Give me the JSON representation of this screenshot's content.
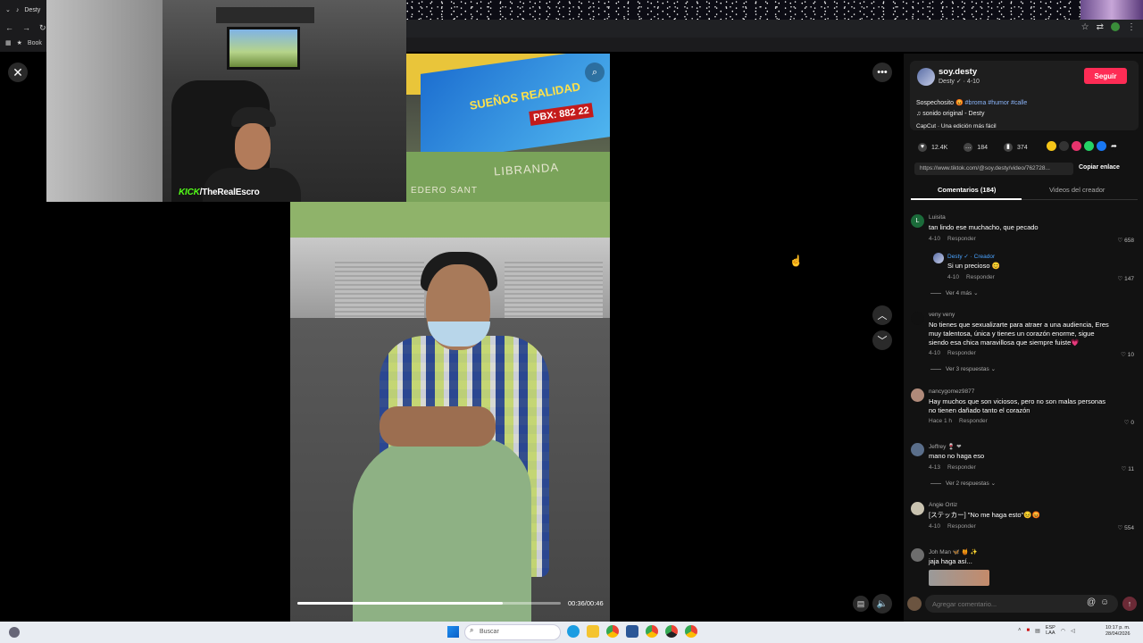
{
  "browser": {
    "tab_title": "Desty",
    "bookmarks_label": "Book"
  },
  "stream_overlay": {
    "kick_brand": "KICK",
    "channel": "/TheRealEscro"
  },
  "video": {
    "sign_text": "SUEÑOS REALIDAD",
    "pbx_text": "PBX: 882 22",
    "wall_text_left": "EDERO SANT",
    "wall_text_right": "LIBRANDA",
    "time": "00:36/00:46",
    "progress": 0.78
  },
  "creator": {
    "handle": "soy.desty",
    "name_line": "Desty ✓ · 4-10",
    "follow_label": "Seguir",
    "desc_text": "Sospechosito 😡",
    "desc_tags": "#broma #humor #calle",
    "music": "♫ sonido original - Desty",
    "capcut": "CapCut · Una edición más fácil"
  },
  "stats": {
    "likes": "12.4K",
    "comments": "184",
    "saves": "374"
  },
  "link": {
    "url": "https://www.tiktok.com/@soy.desty/video/762728...",
    "copy_label": "Copiar enlace"
  },
  "tabs": {
    "comments": "Comentarios (184)",
    "videos": "Videos del creador"
  },
  "comments": [
    {
      "user": "Luisita",
      "text": "tan lindo ese muchacho, que pecado",
      "date": "4-10",
      "reply": "Responder",
      "likes": "658"
    },
    {
      "user": "Desty ✓ · Creador",
      "text": "Si un precioso 😊",
      "date": "4-10",
      "reply": "Responder",
      "likes": "147",
      "more": "Ver 4 más"
    },
    {
      "user": "veny veny",
      "text": "No tienes que sexualizarte para atraer a una audiencia, Eres muy talentosa, única y tienes un corazón enorme, sigue siendo esa chica maravillosa que siempre fuiste💗",
      "date": "4-10",
      "reply": "Responder",
      "likes": "10",
      "more": "Ver 3 respuestas"
    },
    {
      "user": "nancygomez9877",
      "text": "Hay muchos que son viciosos, pero no son malas personas no tienen dañado tanto el corazón",
      "date": "Hace 1 h",
      "reply": "Responder",
      "likes": "0"
    },
    {
      "user": "Jeffrey 🍷 ❤",
      "text": "mano no haga eso",
      "date": "4-13",
      "reply": "Responder",
      "likes": "11",
      "more": "Ver 2 respuestas"
    },
    {
      "user": "Angie Ortiz",
      "text": "[ステッカー] \"No me haga esto\"😣😡",
      "date": "4-10",
      "reply": "Responder",
      "likes": "554"
    },
    {
      "user": "Joh Man 🦋 🍯 ✨",
      "text": "jaja haga así..."
    }
  ],
  "comment_input": {
    "placeholder": "Agregar comentario..."
  },
  "taskbar": {
    "search": "Buscar",
    "lang_top": "ESP",
    "lang_bottom": "LAA",
    "time": "10:17 p. m.",
    "date": "28/04/2026"
  }
}
